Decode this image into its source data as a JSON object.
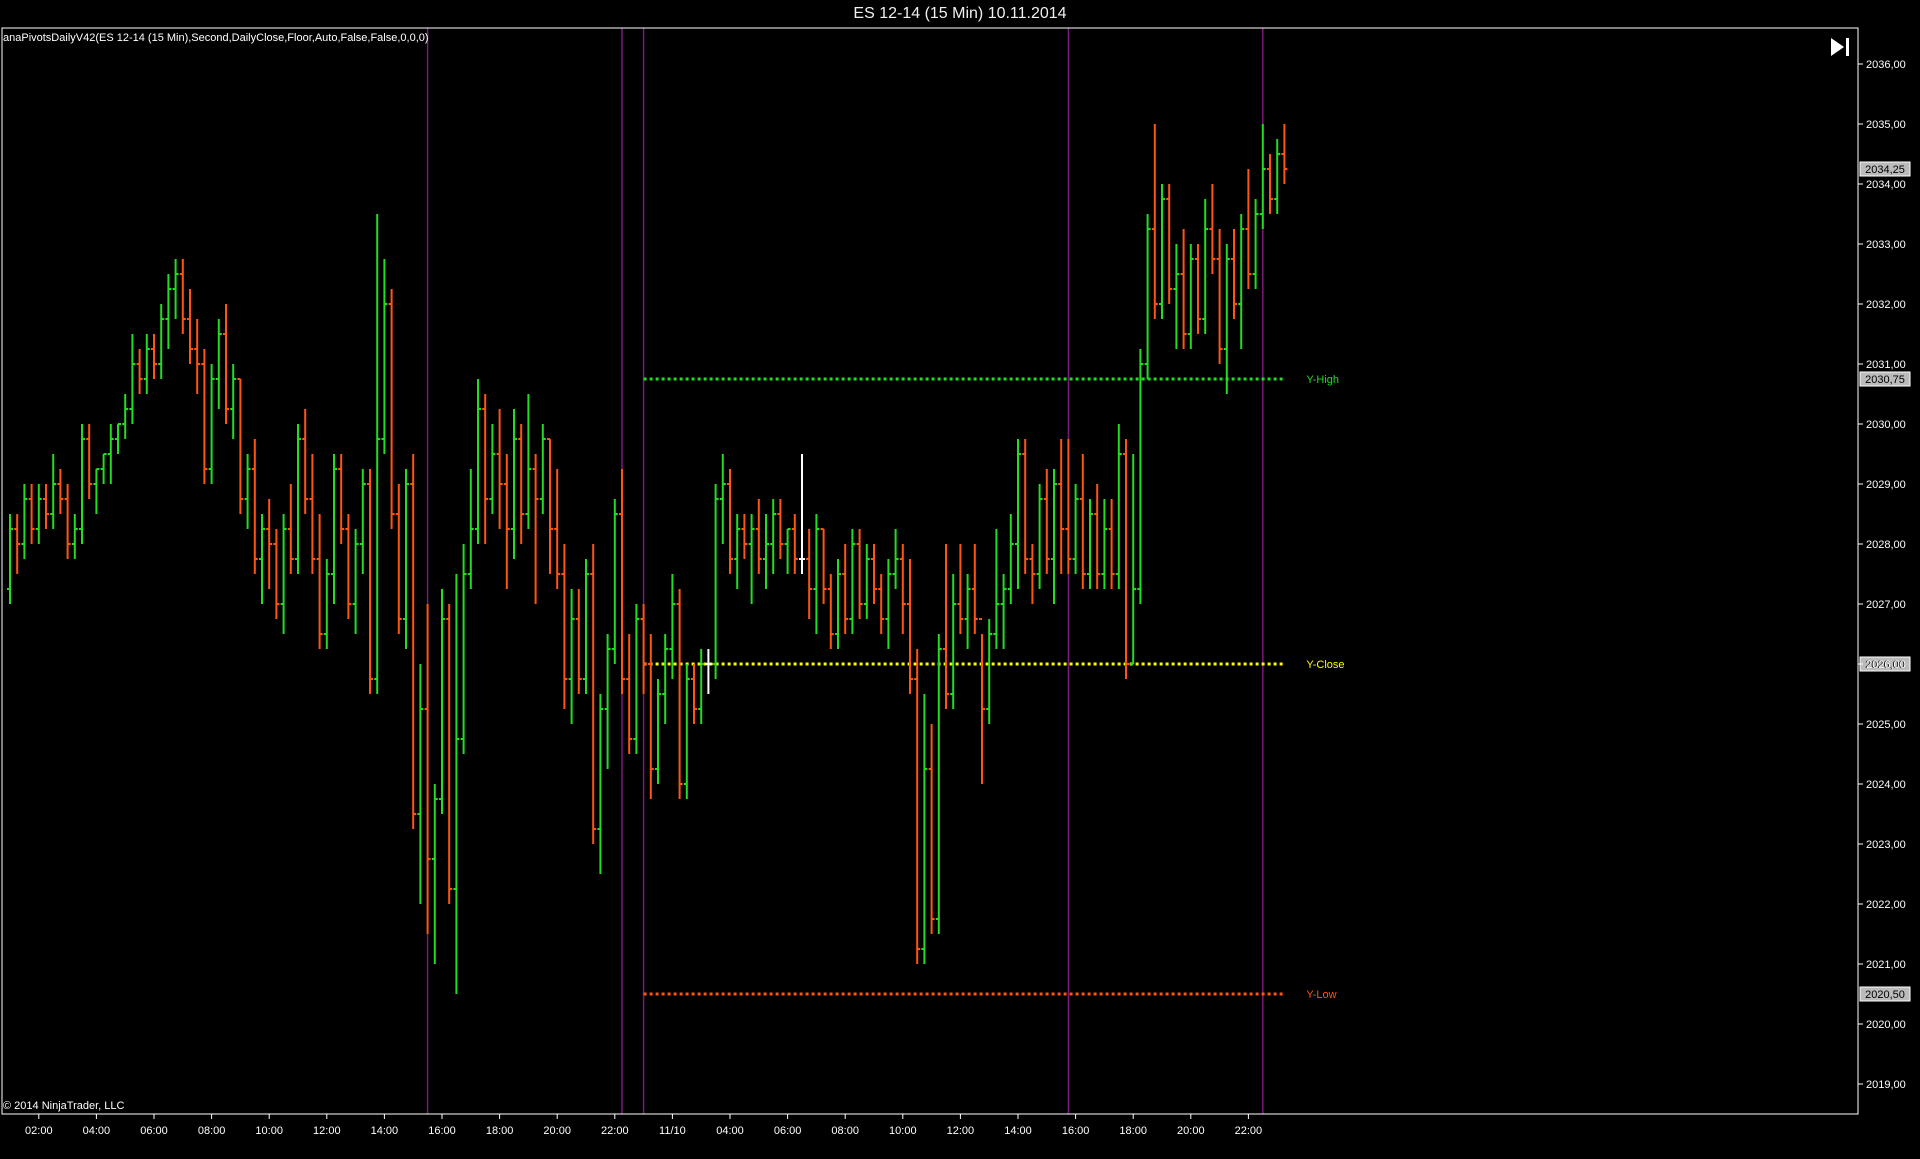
{
  "window": {
    "title": "ES 12-14 (15 Min)  10.11.2014"
  },
  "indicator_label": "anaPivotsDailyV42(ES 12-14 (15 Min),Second,DailyClose,Floor,Auto,False,False,0,0,0)",
  "copyright": "© 2014 NinjaTrader, LLC",
  "icons": {
    "scroll_end": "skip-to-end-icon"
  },
  "colors": {
    "background": "#000000",
    "up": "#22dd22",
    "down": "#ff5511",
    "doji": "#ffffff",
    "session_line": "#7a1a7a",
    "axis": "#ffffff"
  },
  "chart_data": {
    "type": "ohlc",
    "instrument": "ES 12-14",
    "interval": "15 Min",
    "ylim": [
      2018.5,
      2036.6
    ],
    "y_ticks": [
      {
        "value": 2019,
        "label": "2019,00"
      },
      {
        "value": 2020,
        "label": "2020,00"
      },
      {
        "value": 2021,
        "label": "2021,00"
      },
      {
        "value": 2022,
        "label": "2022,00"
      },
      {
        "value": 2023,
        "label": "2023,00"
      },
      {
        "value": 2024,
        "label": "2024,00"
      },
      {
        "value": 2025,
        "label": "2025,00"
      },
      {
        "value": 2026,
        "label": "2026,00"
      },
      {
        "value": 2027,
        "label": "2027,00"
      },
      {
        "value": 2028,
        "label": "2028,00"
      },
      {
        "value": 2029,
        "label": "2029,00"
      },
      {
        "value": 2030,
        "label": "2030,00"
      },
      {
        "value": 2031,
        "label": "2031,00"
      },
      {
        "value": 2032,
        "label": "2032,00"
      },
      {
        "value": 2033,
        "label": "2033,00"
      },
      {
        "value": 2034,
        "label": "2034,00"
      },
      {
        "value": 2035,
        "label": "2035,00"
      },
      {
        "value": 2036,
        "label": "2036,00"
      }
    ],
    "x_ticks": [
      {
        "bar": 4,
        "label": "02:00"
      },
      {
        "bar": 12,
        "label": "04:00"
      },
      {
        "bar": 20,
        "label": "06:00"
      },
      {
        "bar": 28,
        "label": "08:00"
      },
      {
        "bar": 36,
        "label": "10:00"
      },
      {
        "bar": 44,
        "label": "12:00"
      },
      {
        "bar": 52,
        "label": "14:00"
      },
      {
        "bar": 60,
        "label": "16:00"
      },
      {
        "bar": 68,
        "label": "18:00"
      },
      {
        "bar": 76,
        "label": "20:00"
      },
      {
        "bar": 84,
        "label": "22:00"
      },
      {
        "bar": 92,
        "label": "11/10"
      },
      {
        "bar": 100,
        "label": "04:00"
      },
      {
        "bar": 108,
        "label": "06:00"
      },
      {
        "bar": 116,
        "label": "08:00"
      },
      {
        "bar": 124,
        "label": "10:00"
      },
      {
        "bar": 132,
        "label": "12:00"
      },
      {
        "bar": 140,
        "label": "14:00"
      },
      {
        "bar": 148,
        "label": "16:00"
      },
      {
        "bar": 156,
        "label": "18:00"
      },
      {
        "bar": 164,
        "label": "20:00"
      },
      {
        "bar": 172,
        "label": "22:00"
      }
    ],
    "session_lines_bar": [
      58,
      85,
      88,
      147,
      174
    ],
    "pivot_lines": [
      {
        "name": "Y-High",
        "value": 2030.75,
        "label": "2030,75",
        "color": "#22dd22",
        "start_bar": 88
      },
      {
        "name": "Y-Close",
        "value": 2026.0,
        "label": "2026,00",
        "color": "#ffff00",
        "start_bar": 88
      },
      {
        "name": "Y-Low",
        "value": 2020.5,
        "label": "2020,50",
        "color": "#ff5511",
        "start_bar": 88
      }
    ],
    "last_price": {
      "value": 2034.25,
      "label": "2034,25"
    },
    "bars": [
      [
        2027.25,
        2028.5,
        2027.0,
        2028.25
      ],
      [
        2028.25,
        2028.5,
        2027.5,
        2028.0
      ],
      [
        2028.0,
        2029.0,
        2027.75,
        2028.75
      ],
      [
        2028.75,
        2029.0,
        2028.0,
        2028.25
      ],
      [
        2028.25,
        2029.0,
        2028.0,
        2028.75
      ],
      [
        2028.75,
        2029.0,
        2028.25,
        2028.5
      ],
      [
        2028.5,
        2029.5,
        2028.25,
        2029.0
      ],
      [
        2029.0,
        2029.25,
        2028.5,
        2028.75
      ],
      [
        2028.75,
        2029.0,
        2027.75,
        2028.0
      ],
      [
        2028.0,
        2028.5,
        2027.75,
        2028.25
      ],
      [
        2028.25,
        2030.0,
        2028.0,
        2029.75
      ],
      [
        2029.75,
        2030.0,
        2028.75,
        2029.0
      ],
      [
        2029.0,
        2029.25,
        2028.5,
        2029.25
      ],
      [
        2029.25,
        2029.5,
        2029.0,
        2029.5
      ],
      [
        2029.5,
        2030.0,
        2029.0,
        2029.75
      ],
      [
        2029.75,
        2030.0,
        2029.5,
        2030.0
      ],
      [
        2030.0,
        2030.5,
        2029.75,
        2030.25
      ],
      [
        2030.25,
        2031.5,
        2030.0,
        2031.0
      ],
      [
        2031.0,
        2031.25,
        2030.5,
        2030.75
      ],
      [
        2030.75,
        2031.5,
        2030.5,
        2031.25
      ],
      [
        2031.25,
        2031.5,
        2030.75,
        2031.0
      ],
      [
        2031.0,
        2032.0,
        2030.75,
        2031.75
      ],
      [
        2031.75,
        2032.5,
        2031.25,
        2032.25
      ],
      [
        2032.25,
        2032.75,
        2031.75,
        2032.5
      ],
      [
        2032.5,
        2032.75,
        2031.5,
        2031.75
      ],
      [
        2031.75,
        2032.25,
        2031.0,
        2031.25
      ],
      [
        2031.25,
        2031.75,
        2030.5,
        2031.0
      ],
      [
        2031.0,
        2031.25,
        2029.0,
        2029.25
      ],
      [
        2029.25,
        2031.0,
        2029.0,
        2030.75
      ],
      [
        2030.75,
        2031.75,
        2030.25,
        2031.5
      ],
      [
        2031.5,
        2032.0,
        2030.0,
        2030.25
      ],
      [
        2030.25,
        2031.0,
        2029.75,
        2030.75
      ],
      [
        2030.75,
        2030.75,
        2028.5,
        2028.75
      ],
      [
        2028.75,
        2029.5,
        2028.25,
        2029.25
      ],
      [
        2029.25,
        2029.75,
        2027.5,
        2027.75
      ],
      [
        2027.75,
        2028.5,
        2027.0,
        2028.25
      ],
      [
        2028.25,
        2028.75,
        2027.25,
        2028.0
      ],
      [
        2028.0,
        2028.25,
        2026.75,
        2027.0
      ],
      [
        2027.0,
        2028.5,
        2026.5,
        2028.25
      ],
      [
        2028.25,
        2029.0,
        2027.5,
        2027.75
      ],
      [
        2027.75,
        2030.0,
        2027.5,
        2029.75
      ],
      [
        2029.75,
        2030.25,
        2028.5,
        2028.75
      ],
      [
        2028.75,
        2029.5,
        2027.5,
        2027.75
      ],
      [
        2027.75,
        2028.5,
        2026.25,
        2026.5
      ],
      [
        2026.5,
        2027.75,
        2026.25,
        2027.5
      ],
      [
        2027.5,
        2029.5,
        2027.0,
        2029.25
      ],
      [
        2029.25,
        2029.5,
        2028.0,
        2028.25
      ],
      [
        2028.25,
        2028.5,
        2026.75,
        2027.0
      ],
      [
        2027.0,
        2028.25,
        2026.5,
        2028.0
      ],
      [
        2028.0,
        2029.25,
        2027.5,
        2029.0
      ],
      [
        2029.0,
        2029.25,
        2025.5,
        2025.75
      ],
      [
        2025.75,
        2033.5,
        2025.5,
        2029.75
      ],
      [
        2029.75,
        2032.75,
        2029.5,
        2032.0
      ],
      [
        2032.0,
        2032.25,
        2028.25,
        2028.5
      ],
      [
        2028.5,
        2029.0,
        2026.5,
        2026.75
      ],
      [
        2026.75,
        2029.25,
        2026.25,
        2029.0
      ],
      [
        2029.0,
        2029.5,
        2023.25,
        2023.5
      ],
      [
        2023.5,
        2026.0,
        2022.0,
        2025.25
      ],
      [
        2025.25,
        2027.0,
        2021.5,
        2022.75
      ],
      [
        2022.75,
        2024.0,
        2021.0,
        2023.75
      ],
      [
        2023.75,
        2027.25,
        2023.5,
        2026.75
      ],
      [
        2026.75,
        2027.0,
        2022.0,
        2022.25
      ],
      [
        2022.25,
        2027.5,
        2020.5,
        2024.75
      ],
      [
        2024.75,
        2028.0,
        2024.5,
        2027.5
      ],
      [
        2027.5,
        2029.25,
        2027.25,
        2028.25
      ],
      [
        2028.25,
        2030.75,
        2028.0,
        2030.25
      ],
      [
        2030.25,
        2030.5,
        2028.0,
        2028.75
      ],
      [
        2028.75,
        2030.0,
        2028.5,
        2029.5
      ],
      [
        2029.5,
        2030.25,
        2028.25,
        2029.0
      ],
      [
        2029.0,
        2029.5,
        2027.25,
        2028.25
      ],
      [
        2028.25,
        2030.25,
        2027.75,
        2029.75
      ],
      [
        2029.75,
        2030.0,
        2028.0,
        2028.5
      ],
      [
        2028.5,
        2030.5,
        2028.25,
        2029.25
      ],
      [
        2029.25,
        2029.5,
        2027.0,
        2028.75
      ],
      [
        2028.75,
        2030.0,
        2028.5,
        2029.75
      ],
      [
        2029.75,
        2029.75,
        2027.5,
        2028.25
      ],
      [
        2028.25,
        2029.25,
        2027.25,
        2027.5
      ],
      [
        2027.5,
        2028.0,
        2025.25,
        2025.75
      ],
      [
        2025.75,
        2027.25,
        2025.0,
        2026.75
      ],
      [
        2026.75,
        2027.25,
        2025.5,
        2025.75
      ],
      [
        2025.75,
        2027.75,
        2025.5,
        2027.5
      ],
      [
        2027.5,
        2028.0,
        2023.0,
        2023.25
      ],
      [
        2023.25,
        2025.5,
        2022.5,
        2025.25
      ],
      [
        2025.25,
        2026.5,
        2024.25,
        2026.25
      ],
      [
        2026.25,
        2028.75,
        2026.0,
        2028.5
      ],
      [
        2028.5,
        2029.25,
        2025.5,
        2025.75
      ],
      [
        2025.75,
        2026.5,
        2024.5,
        2024.75
      ],
      [
        2024.75,
        2027.0,
        2024.5,
        2026.75
      ],
      [
        2026.75,
        2027.0,
        2025.5,
        2026.0
      ],
      [
        2026.0,
        2026.5,
        2023.75,
        2024.25
      ],
      [
        2024.25,
        2025.75,
        2024.0,
        2025.5
      ],
      [
        2025.5,
        2026.5,
        2025.0,
        2026.25
      ],
      [
        2026.25,
        2027.5,
        2025.75,
        2027.0
      ],
      [
        2027.0,
        2027.25,
        2023.75,
        2024.0
      ],
      [
        2024.0,
        2026.0,
        2023.75,
        2025.75
      ],
      [
        2025.75,
        2026.0,
        2025.0,
        2025.25
      ],
      [
        2025.25,
        2026.25,
        2025.0,
        2026.0
      ],
      [
        2026.0,
        2026.25,
        2025.5,
        2026.0
      ],
      [
        2026.0,
        2029.0,
        2025.75,
        2028.75
      ],
      [
        2028.75,
        2029.5,
        2028.0,
        2029.0
      ],
      [
        2029.0,
        2029.25,
        2027.5,
        2027.75
      ],
      [
        2027.75,
        2028.5,
        2027.25,
        2028.25
      ],
      [
        2028.25,
        2028.5,
        2027.75,
        2028.0
      ],
      [
        2028.0,
        2028.5,
        2027.0,
        2028.25
      ],
      [
        2028.25,
        2028.75,
        2027.5,
        2027.75
      ],
      [
        2027.75,
        2028.5,
        2027.25,
        2028.0
      ],
      [
        2028.0,
        2028.75,
        2027.5,
        2028.5
      ],
      [
        2028.5,
        2028.75,
        2027.75,
        2028.0
      ],
      [
        2028.0,
        2028.25,
        2027.5,
        2028.25
      ],
      [
        2028.25,
        2028.5,
        2027.5,
        2027.75
      ],
      [
        2027.75,
        2029.5,
        2027.5,
        2027.75
      ],
      [
        2027.75,
        2028.25,
        2026.75,
        2027.25
      ],
      [
        2027.25,
        2028.5,
        2026.5,
        2028.25
      ],
      [
        2028.25,
        2028.25,
        2027.0,
        2027.25
      ],
      [
        2027.25,
        2027.5,
        2026.25,
        2026.5
      ],
      [
        2026.5,
        2027.75,
        2026.25,
        2027.5
      ],
      [
        2027.5,
        2028.0,
        2026.5,
        2026.75
      ],
      [
        2026.75,
        2028.25,
        2026.5,
        2028.0
      ],
      [
        2028.0,
        2028.25,
        2026.75,
        2027.0
      ],
      [
        2027.0,
        2028.0,
        2026.75,
        2027.75
      ],
      [
        2027.75,
        2028.0,
        2027.0,
        2027.25
      ],
      [
        2027.25,
        2027.5,
        2026.5,
        2026.75
      ],
      [
        2026.75,
        2027.75,
        2026.25,
        2027.5
      ],
      [
        2027.5,
        2028.25,
        2027.25,
        2027.75
      ],
      [
        2027.75,
        2028.0,
        2026.5,
        2027.0
      ],
      [
        2027.0,
        2027.75,
        2025.5,
        2025.75
      ],
      [
        2025.75,
        2026.25,
        2021.0,
        2021.25
      ],
      [
        2021.25,
        2025.5,
        2021.0,
        2024.25
      ],
      [
        2024.25,
        2025.0,
        2021.5,
        2021.75
      ],
      [
        2021.75,
        2026.5,
        2021.5,
        2026.25
      ],
      [
        2026.25,
        2028.0,
        2025.25,
        2025.5
      ],
      [
        2025.5,
        2027.5,
        2025.25,
        2027.0
      ],
      [
        2027.0,
        2028.0,
        2026.5,
        2026.75
      ],
      [
        2026.75,
        2027.5,
        2026.25,
        2027.25
      ],
      [
        2027.25,
        2028.0,
        2026.5,
        2026.75
      ],
      [
        2026.75,
        2026.5,
        2024.0,
        2025.25
      ],
      [
        2025.25,
        2026.75,
        2025.0,
        2026.5
      ],
      [
        2026.5,
        2028.25,
        2026.25,
        2027.0
      ],
      [
        2027.0,
        2027.5,
        2026.25,
        2027.25
      ],
      [
        2027.25,
        2028.5,
        2027.0,
        2028.0
      ],
      [
        2028.0,
        2029.75,
        2027.25,
        2029.5
      ],
      [
        2029.5,
        2029.75,
        2027.5,
        2027.75
      ],
      [
        2027.75,
        2028.0,
        2027.0,
        2027.5
      ],
      [
        2027.5,
        2029.0,
        2027.25,
        2028.75
      ],
      [
        2028.75,
        2029.25,
        2027.5,
        2027.75
      ],
      [
        2027.75,
        2029.25,
        2027.0,
        2029.0
      ],
      [
        2029.0,
        2029.75,
        2027.5,
        2028.25
      ],
      [
        2028.25,
        2029.75,
        2027.5,
        2027.75
      ],
      [
        2027.75,
        2029.0,
        2027.5,
        2028.75
      ],
      [
        2028.75,
        2029.5,
        2027.25,
        2027.5
      ],
      [
        2027.5,
        2028.75,
        2027.25,
        2028.5
      ],
      [
        2028.5,
        2029.0,
        2027.25,
        2027.5
      ],
      [
        2027.5,
        2028.75,
        2027.25,
        2028.25
      ],
      [
        2028.25,
        2028.75,
        2027.25,
        2027.5
      ],
      [
        2027.5,
        2030.0,
        2027.25,
        2029.5
      ],
      [
        2029.5,
        2029.75,
        2025.75,
        2026.0
      ],
      [
        2026.0,
        2029.5,
        2026.0,
        2027.25
      ],
      [
        2027.25,
        2031.25,
        2027.0,
        2031.0
      ],
      [
        2031.0,
        2033.5,
        2030.75,
        2033.25
      ],
      [
        2033.25,
        2035.0,
        2031.75,
        2032.0
      ],
      [
        2032.0,
        2034.0,
        2031.75,
        2033.75
      ],
      [
        2033.75,
        2034.0,
        2032.0,
        2032.25
      ],
      [
        2032.25,
        2033.0,
        2031.25,
        2032.5
      ],
      [
        2032.5,
        2033.25,
        2031.25,
        2031.5
      ],
      [
        2031.5,
        2033.0,
        2031.25,
        2032.75
      ],
      [
        2032.75,
        2033.0,
        2031.5,
        2031.75
      ],
      [
        2031.75,
        2033.75,
        2031.5,
        2033.25
      ],
      [
        2033.25,
        2034.0,
        2032.5,
        2032.75
      ],
      [
        2032.75,
        2033.25,
        2031.0,
        2031.25
      ],
      [
        2031.25,
        2033.0,
        2030.5,
        2032.75
      ],
      [
        2032.75,
        2033.25,
        2031.75,
        2032.0
      ],
      [
        2032.0,
        2033.5,
        2031.25,
        2033.25
      ],
      [
        2033.25,
        2034.25,
        2032.25,
        2032.5
      ],
      [
        2032.5,
        2033.75,
        2032.25,
        2033.5
      ],
      [
        2033.5,
        2035.0,
        2033.25,
        2034.25
      ],
      [
        2034.25,
        2034.5,
        2033.5,
        2033.75
      ],
      [
        2033.75,
        2034.75,
        2033.5,
        2034.5
      ],
      [
        2034.5,
        2035.0,
        2034.0,
        2034.25
      ]
    ]
  }
}
